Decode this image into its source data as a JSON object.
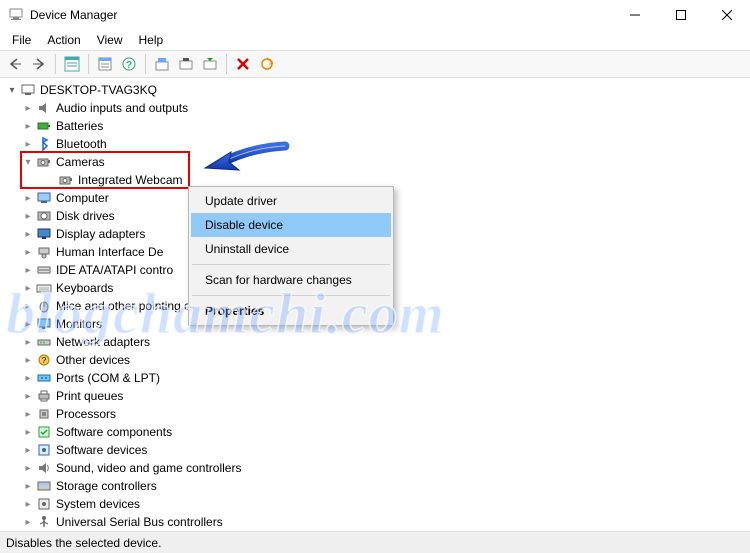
{
  "window": {
    "title": "Device Manager"
  },
  "menu": {
    "items": [
      "File",
      "Action",
      "View",
      "Help"
    ]
  },
  "tree": {
    "root": "DESKTOP-TVAG3KQ",
    "selected": "Integrated Webcam",
    "nodes": [
      {
        "label": "Audio inputs and outputs",
        "icon": "audio"
      },
      {
        "label": "Batteries",
        "icon": "battery"
      },
      {
        "label": "Bluetooth",
        "icon": "bluetooth"
      },
      {
        "label": "Cameras",
        "icon": "camera",
        "expanded": true,
        "children": [
          {
            "label": "Integrated Webcam",
            "icon": "camera"
          }
        ]
      },
      {
        "label": "Computer",
        "icon": "computer"
      },
      {
        "label": "Disk drives",
        "icon": "disk"
      },
      {
        "label": "Display adapters",
        "icon": "display"
      },
      {
        "label": "Human Interface Devices",
        "icon": "hid",
        "truncate": "Human Interface De"
      },
      {
        "label": "IDE ATA/ATAPI controllers",
        "icon": "ide",
        "truncate": "IDE ATA/ATAPI contro"
      },
      {
        "label": "Keyboards",
        "icon": "keyboard"
      },
      {
        "label": "Mice and other pointing devices",
        "icon": "mouse",
        "truncate": "Mice and other pointing devices"
      },
      {
        "label": "Monitors",
        "icon": "monitor"
      },
      {
        "label": "Network adapters",
        "icon": "network"
      },
      {
        "label": "Other devices",
        "icon": "other"
      },
      {
        "label": "Ports (COM & LPT)",
        "icon": "port"
      },
      {
        "label": "Print queues",
        "icon": "printer"
      },
      {
        "label": "Processors",
        "icon": "cpu"
      },
      {
        "label": "Software components",
        "icon": "swcomp"
      },
      {
        "label": "Software devices",
        "icon": "swdev"
      },
      {
        "label": "Sound, video and game controllers",
        "icon": "sound"
      },
      {
        "label": "Storage controllers",
        "icon": "storage"
      },
      {
        "label": "System devices",
        "icon": "system"
      },
      {
        "label": "Universal Serial Bus controllers",
        "icon": "usb"
      }
    ]
  },
  "context_menu": {
    "items": [
      {
        "label": "Update driver"
      },
      {
        "label": "Disable device",
        "hover": true
      },
      {
        "label": "Uninstall device"
      },
      {
        "sep": true
      },
      {
        "label": "Scan for hardware changes"
      },
      {
        "sep": true
      },
      {
        "label": "Properties",
        "bold": true
      }
    ]
  },
  "status": "Disables the selected device.",
  "watermark": "blogchamchi.com"
}
